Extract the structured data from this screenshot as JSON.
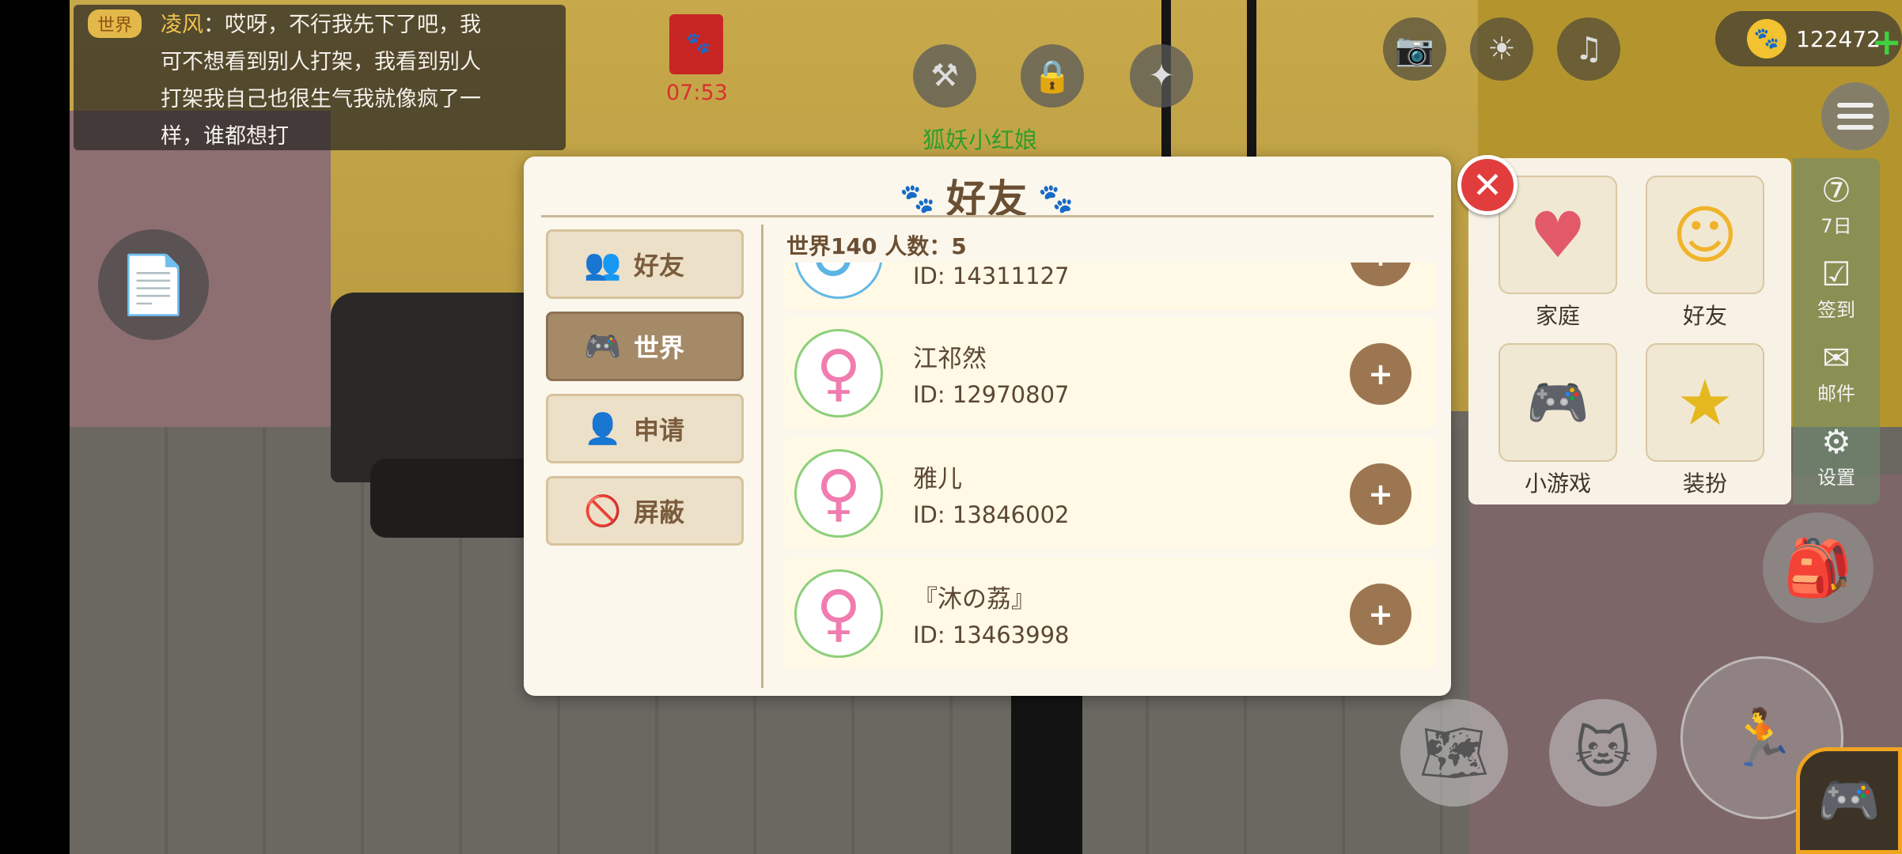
{
  "chat": {
    "channel": "世界",
    "sender": "凌风",
    "line1": "：哎呀，不行我先下了吧，我",
    "line2": "可不想看到别人打架，我看到别人",
    "line3": "打架我自己也很生气我就像疯了一",
    "line4": "样，谁都想打"
  },
  "top": {
    "timer": "07:53",
    "npc_label": "狐妖小红娘",
    "coins": "122472",
    "coin_plus": "+"
  },
  "quick_panel": {
    "items": [
      {
        "label": "家庭",
        "icon": "heart-icon"
      },
      {
        "label": "好友",
        "icon": "friends-icon"
      },
      {
        "label": "小游戏",
        "icon": "gamepad-icon"
      },
      {
        "label": "装扮",
        "icon": "wand-icon"
      }
    ],
    "side": [
      {
        "label": "7日",
        "icon": "seven-day-icon"
      },
      {
        "label": "签到",
        "icon": "checkin-icon"
      },
      {
        "label": "邮件",
        "icon": "mail-icon"
      },
      {
        "label": "设置",
        "icon": "gear-icon"
      }
    ]
  },
  "dialog": {
    "title": "好友",
    "close_label": "✕",
    "tabs": [
      {
        "label": "好友",
        "icon": "friends-icon",
        "active": false
      },
      {
        "label": "世界",
        "icon": "gamepad-icon",
        "active": true
      },
      {
        "label": "申请",
        "icon": "add-person-icon",
        "active": false
      },
      {
        "label": "屏蔽",
        "icon": "block-person-icon",
        "active": false
      }
    ],
    "list_header": "世界140  人数：5",
    "rows": [
      {
        "name": "",
        "id": "ID: 14311127",
        "gender": "male"
      },
      {
        "name": "江祁然",
        "id": "ID: 12970807",
        "gender": "female"
      },
      {
        "name": "雅儿",
        "id": "ID: 13846002",
        "gender": "female"
      },
      {
        "name": "『沐の荔』",
        "id": "ID: 13463998",
        "gender": "female"
      }
    ]
  },
  "colors": {
    "accent_brown": "#6b4f33",
    "tab_active": "#a58a68",
    "close_red": "#e23d3d",
    "female_pink": "#f07cb0",
    "coin_gold": "#f2c230"
  }
}
